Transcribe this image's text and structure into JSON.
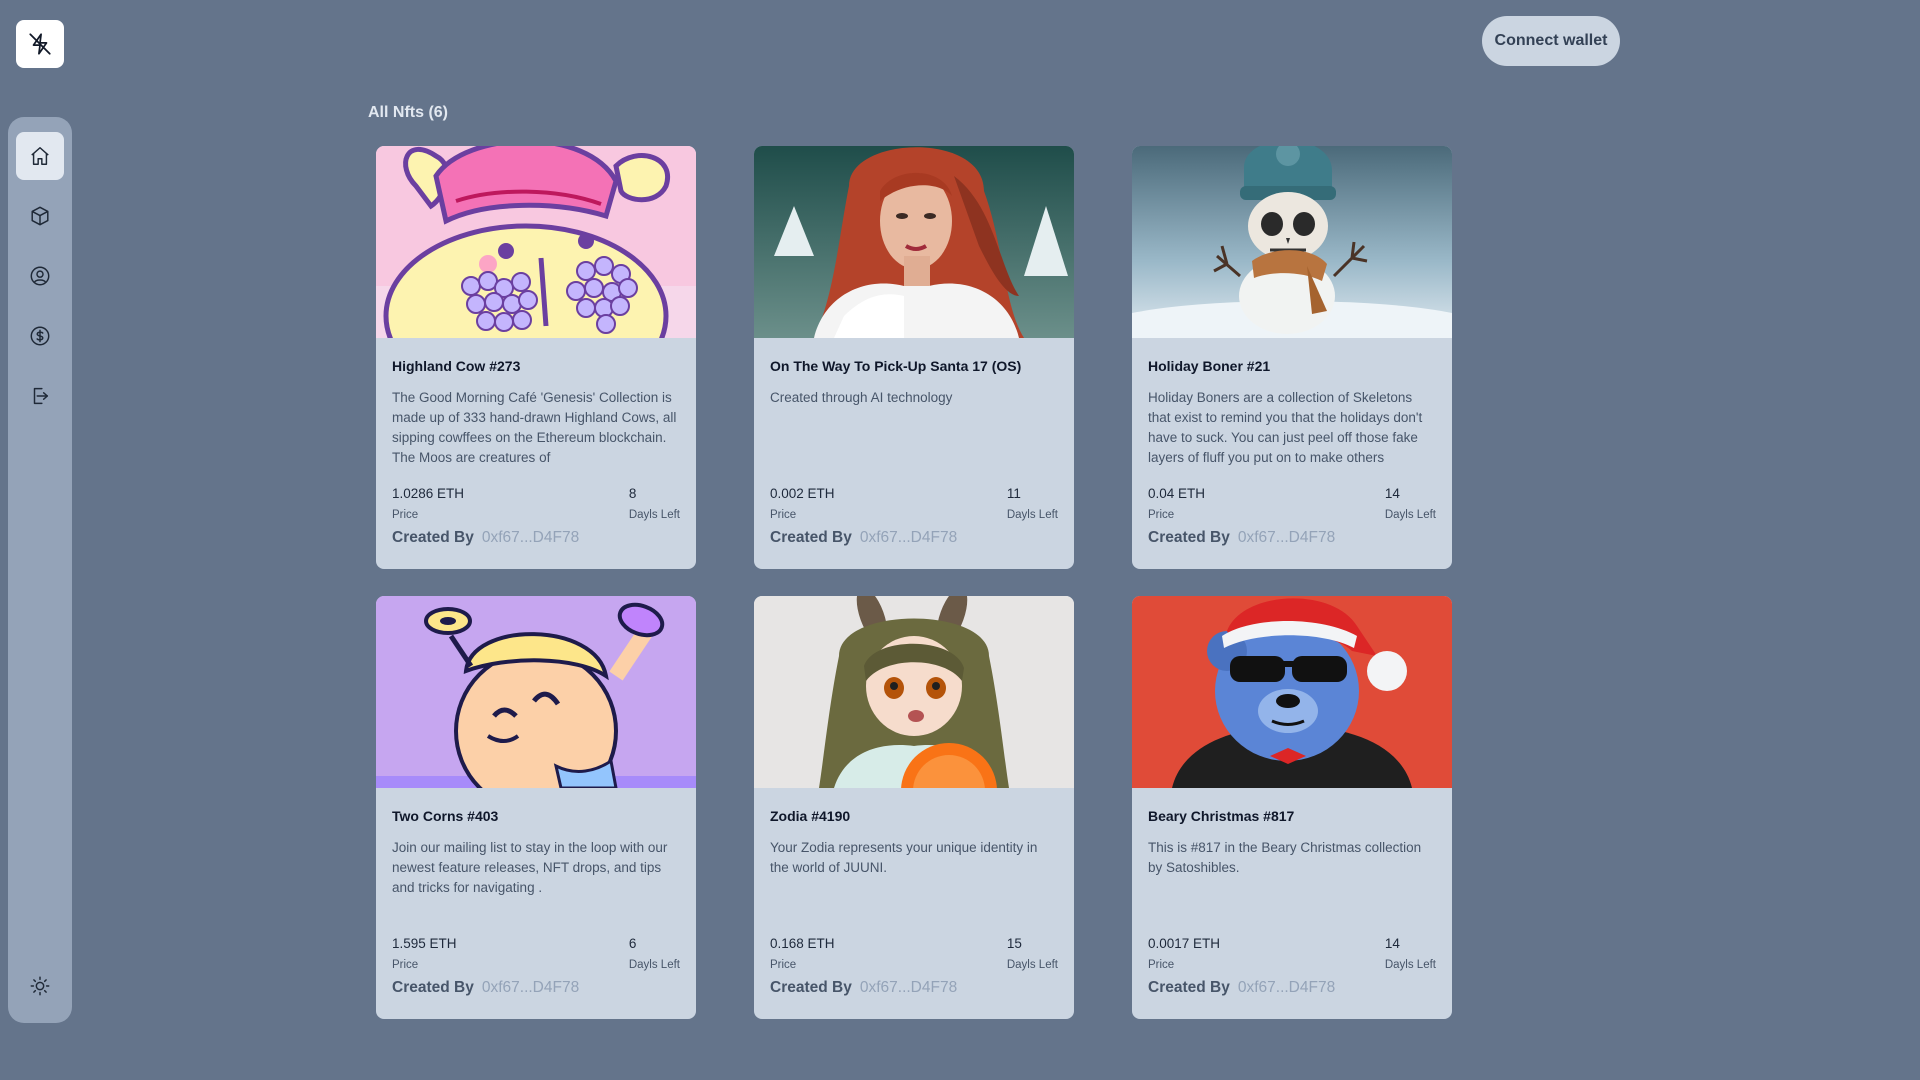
{
  "app": {
    "connect_label": "Connect wallet"
  },
  "sidebar": {
    "items": [
      {
        "icon": "home-icon",
        "active": true
      },
      {
        "icon": "cube-icon",
        "active": false
      },
      {
        "icon": "user-circle-icon",
        "active": false
      },
      {
        "icon": "dollar-circle-icon",
        "active": false
      },
      {
        "icon": "logout-icon",
        "active": false
      }
    ],
    "theme_icon": "sun-icon"
  },
  "section": {
    "title": "All Nfts (6)"
  },
  "nfts": [
    {
      "title": "Highland Cow #273",
      "description": "The Good Morning Café 'Genesis' Collection is made up of 333 hand-drawn Highland Cows, all sipping cowffees on the Ethereum blockchain. The Moos are creatures of",
      "price": "1.0286 ETH",
      "price_label": "Price",
      "days": "8",
      "days_label": "Dayls Left",
      "created_by_label": "Created By",
      "creator": "0xf67...D4F78",
      "image": "highland-cow-artwork"
    },
    {
      "title": "On The Way To Pick-Up Santa 17 (OS)",
      "description": "Created through AI technology",
      "price": "0.002 ETH",
      "price_label": "Price",
      "days": "11",
      "days_label": "Dayls Left",
      "created_by_label": "Created By",
      "creator": "0xf67...D4F78",
      "image": "red-haired-woman-portrait"
    },
    {
      "title": "Holiday Boner #21",
      "description": "Holiday Boners are a collection of Skeletons that exist to remind you that the holidays don't have to suck. You can just peel off those fake layers of fluff you put on to make others",
      "price": "0.04 ETH",
      "price_label": "Price",
      "days": "14",
      "days_label": "Dayls Left",
      "created_by_label": "Created By",
      "creator": "0xf67...D4F78",
      "image": "skeleton-snowman-artwork"
    },
    {
      "title": "Two Corns #403",
      "description": "Join our mailing list to stay in the loop with our newest feature releases, NFT drops, and tips and tricks for navigating .",
      "price": "1.595 ETH",
      "price_label": "Price",
      "days": "6",
      "days_label": "Dayls Left",
      "created_by_label": "Created By",
      "creator": "0xf67...D4F78",
      "image": "two-corns-cartoon"
    },
    {
      "title": "Zodia #4190",
      "description": "Your Zodia represents your unique identity in the world of JUUNI.",
      "price": "0.168 ETH",
      "price_label": "Price",
      "days": "15",
      "days_label": "Dayls Left",
      "created_by_label": "Created By",
      "creator": "0xf67...D4F78",
      "image": "anime-girl-artwork"
    },
    {
      "title": "Beary Christmas #817",
      "description": "This is #817 in the Beary Christmas collection by Satoshibles.",
      "price": "0.0017 ETH",
      "price_label": "Price",
      "days": "14",
      "days_label": "Dayls Left",
      "created_by_label": "Created By",
      "creator": "0xf67...D4F78",
      "image": "blue-bear-santa-hat"
    }
  ]
}
